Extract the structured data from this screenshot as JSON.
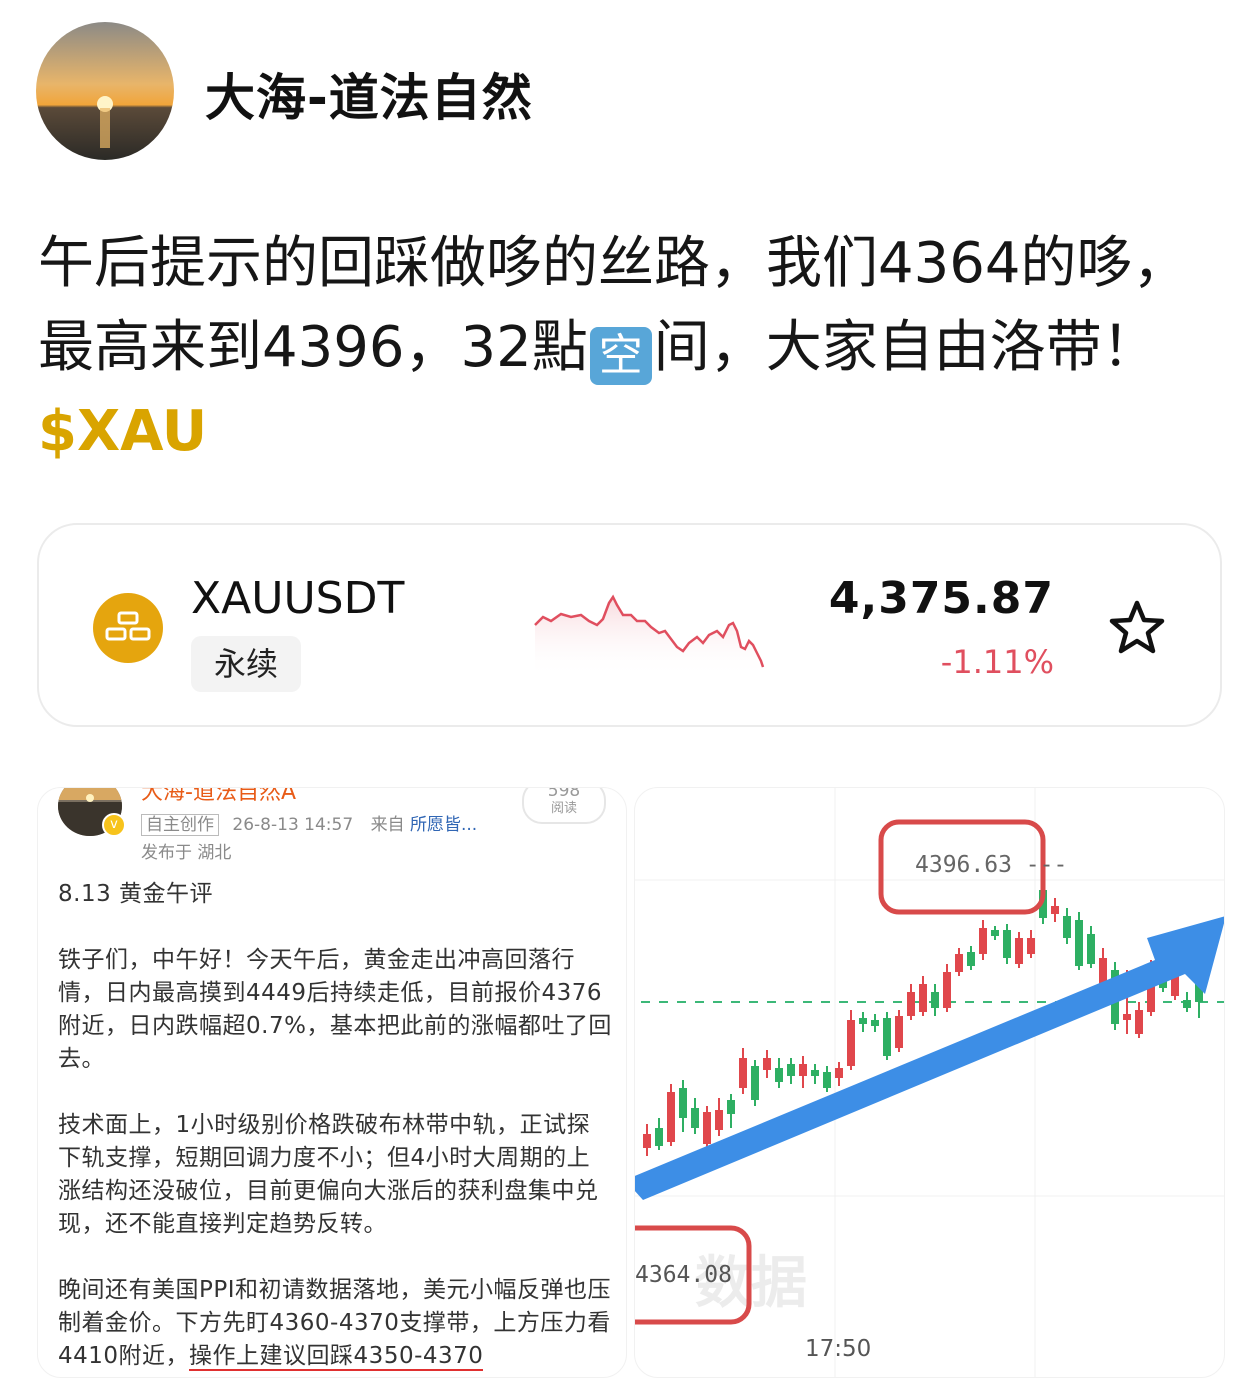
{
  "author": {
    "name": "大海-道法自然"
  },
  "post": {
    "text": "午后提示的回踩做哆的丝路，我们4364的哆，最高来到4396，32點",
    "emoji": "空",
    "text2": "间，大家自由洛带！",
    "tag": "$XAU"
  },
  "ticker": {
    "symbol": "XAUUSDT",
    "type": "永续",
    "price": "4,375.87",
    "change": "-1.11%",
    "change_color": "#e04f5f",
    "icon": "gold-bars-icon",
    "favorite_icon": "star-icon"
  },
  "screenshot_left": {
    "name": "大海-道法自然A",
    "reads_count": "598",
    "reads_label": "阅读",
    "original_badge": "自主创作",
    "datetime": "26-8-13 14:57",
    "from_label": "来自",
    "source": "所愿皆...",
    "location": "发布于 湖北",
    "title": "8.13 黄金午评",
    "para1": "铁子们，中午好！今天午后，黄金走出冲高回落行情，日内最高摸到4449后持续走低，目前报价4376附近，日内跌幅超0.7%，基本把此前的涨幅都吐了回去。",
    "para2": "技术面上，1小时级别价格跌破布林带中轨，正试探下轨支撑，短期回调力度不小；但4小时大周期的上涨结构还没破位，目前更偏向大涨后的获利盘集中兑现，还不能直接判定趋势反转。",
    "para3_a": "晚间还有美国PPI和初请数据落地，美元小幅反弹也压制着金价。下方先盯4360-4370支撑带，上方压力看4410附近，",
    "para3_b": "操作上建议回踩4350-4370"
  },
  "screenshot_right": {
    "high_label": "4396.63",
    "low_label": "4364.08",
    "time_label": "17:50",
    "watermark": "数据"
  }
}
